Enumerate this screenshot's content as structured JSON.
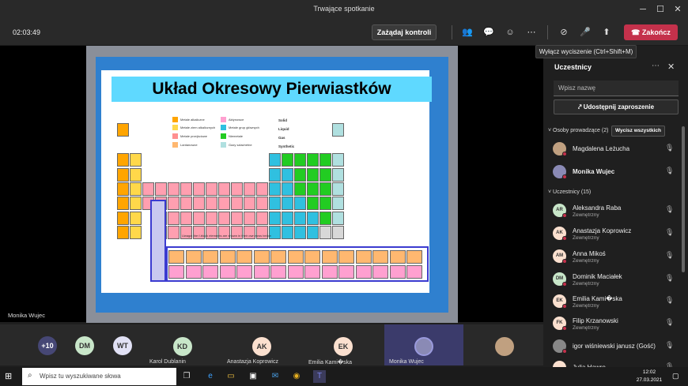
{
  "window": {
    "title": "Trwające spotkanie",
    "minimize_glyph": "─",
    "maximize_glyph": "☐",
    "close_glyph": "✕"
  },
  "toolbar": {
    "timer": "02:03:49",
    "control_label": "Zażądaj kontroli",
    "end_label": "Zakończ",
    "tooltip": "Wyłącz wyciszenie (Ctrl+Shift+M)",
    "icons": {
      "participants": "👥",
      "chat": "💬",
      "reactions": "☺",
      "more": "⋯",
      "camera_off": "⊘",
      "mic_off": "🎤",
      "share": "⬆"
    }
  },
  "slide": {
    "title": "Układ Okresowy Pierwiastków",
    "legend": [
      {
        "label": "Metale alkaliczne",
        "color": "#ffa500"
      },
      {
        "label": "Metale ziem alkalicznych",
        "color": "#ffd84a"
      },
      {
        "label": "Metale przejściowe",
        "color": "#ff9090"
      },
      {
        "label": "Lantanowce",
        "color": "#ffb870"
      },
      {
        "label": "Aktynowce",
        "color": "#ffa0d0"
      },
      {
        "label": "Metale grup głównych",
        "color": "#30c0e0"
      },
      {
        "label": "Niemetale",
        "color": "#22cc22"
      },
      {
        "label": "Gazy szlachetne",
        "color": "#b0e0e0"
      }
    ],
    "states": [
      "Solid",
      "Liquid",
      "Gas",
      "Synthetic"
    ],
    "footnote": "Uwaga: the f-block elements are shown in their own rows below"
  },
  "stage_label": "Monika Wujec",
  "gallery": [
    {
      "initials": "+10",
      "name": "",
      "color": "#464775"
    },
    {
      "initials": "DM",
      "name": "",
      "color": "#c8e6c9"
    },
    {
      "initials": "WT",
      "name": "",
      "color": "#e1e1f5"
    },
    {
      "initials": "KD",
      "name": "Karol Dublanin",
      "color": "#c8e6c9"
    },
    {
      "initials": "AK",
      "name": "Anastazja Koprowicz",
      "color": "#fbe0cf"
    },
    {
      "initials": "EK",
      "name": "Emilia Kami�ska",
      "color": "#fbe0cf"
    },
    {
      "initials": "",
      "name": "Monika Wujec",
      "color": "#8a8ab5"
    },
    {
      "initials": "",
      "name": "",
      "color": "#c0a080"
    }
  ],
  "panel": {
    "title": "Uczestnicy",
    "more_glyph": "⋯",
    "close_glyph": "✕",
    "search_placeholder": "Wpisz nazwę",
    "share_label": "Udostępnij zaproszenie",
    "presenters_head": "˅  Osoby prowadzące (2)",
    "mute_all_label": "Wycisz wszystkich",
    "attendees_head": "˅  Uczestnicy (15)",
    "presenters": [
      {
        "initials": "",
        "name": "Magdalena Leżucha",
        "sub": "",
        "color": "#c0a080"
      },
      {
        "initials": "",
        "name": "Monika Wujec",
        "sub": "",
        "color": "#8a8ab5"
      }
    ],
    "attendees": [
      {
        "initials": "AR",
        "name": "Aleksandra Raba",
        "sub": "Zewnętrzny",
        "color": "#c8e6c9"
      },
      {
        "initials": "AK",
        "name": "Anastazja Koprowicz",
        "sub": "Zewnętrzny",
        "color": "#fbe0cf"
      },
      {
        "initials": "AM",
        "name": "Anna Mikoś",
        "sub": "Zewnętrzny",
        "color": "#fbe0cf"
      },
      {
        "initials": "DM",
        "name": "Dominik Maciałek",
        "sub": "Zewnętrzny",
        "color": "#c8e6c9"
      },
      {
        "initials": "EK",
        "name": "Emilia Kami�ska",
        "sub": "Zewnętrzny",
        "color": "#fbe0cf"
      },
      {
        "initials": "FK",
        "name": "Filip Krzanowski",
        "sub": "Zewnętrzny",
        "color": "#fbe0cf"
      },
      {
        "initials": "",
        "name": "igor wiśniewski janusz (Gość)",
        "sub": "",
        "color": "#888"
      },
      {
        "initials": "",
        "name": "Julia Hawro",
        "sub": "",
        "color": "#fbe0cf"
      }
    ]
  },
  "taskbar": {
    "search_placeholder": "Wpisz tu wyszukiwane słowa",
    "time": "12:02",
    "date": "27.03.2021"
  }
}
